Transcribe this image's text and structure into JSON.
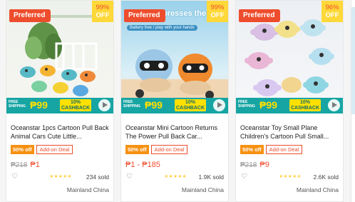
{
  "products": [
    {
      "badge": "Preferred",
      "discount_pct": "99%",
      "discount_label": "OFF",
      "promo": {
        "shipping": "FREE SHIPPING",
        "amount": "₱99",
        "cashback": "10% CASHBACK"
      },
      "title": "Oceanstar 1pcs Cartoon Pull Back Animal Cars Cute Little...",
      "tag_discount": "50% off",
      "tag_addon": "Add-on Deal",
      "price_original": "₱218",
      "price_current": "₱1",
      "rating_stars": "★★★★★",
      "sold": "234 sold",
      "location": "Mainland China"
    },
    {
      "badge": "Preferred",
      "discount_pct": "99%",
      "discount_label": "OFF",
      "banner_text": "presses the car",
      "banner_sub": "Battery free / play with your hands",
      "promo": {
        "shipping": "FREE SHIPPING",
        "amount": "₱99",
        "cashback": "10% CASHBACK"
      },
      "title": "Oceanstar Mini Cartoon Returns The Power Pull Back Car...",
      "tag_discount": "50% off",
      "tag_addon": "Add-on Deal",
      "price_original": "",
      "price_current": "₱1 - ₱185",
      "rating_stars": "★★★★★",
      "sold": "1.9K sold",
      "location": "Mainland China"
    },
    {
      "badge": "Preferred",
      "discount_pct": "96%",
      "discount_label": "OFF",
      "promo": {
        "shipping": "FREE SHIPPING",
        "amount": "₱99",
        "cashback": "10% CASHBACK"
      },
      "title": "Oceanstar Toy Small Plane Children's Cartoon Pull Small...",
      "tag_discount": "50% off",
      "tag_addon": "Add-on Deal",
      "price_original": "₱218",
      "price_current": "₱9",
      "rating_stars": "★★★★★",
      "sold": "2.6K sold",
      "location": "Mainland China"
    }
  ],
  "colors": {
    "brand": "#ee4d2d",
    "promo": "#17a5a4",
    "offer": "#ffd839",
    "star": "#ffce3d"
  }
}
